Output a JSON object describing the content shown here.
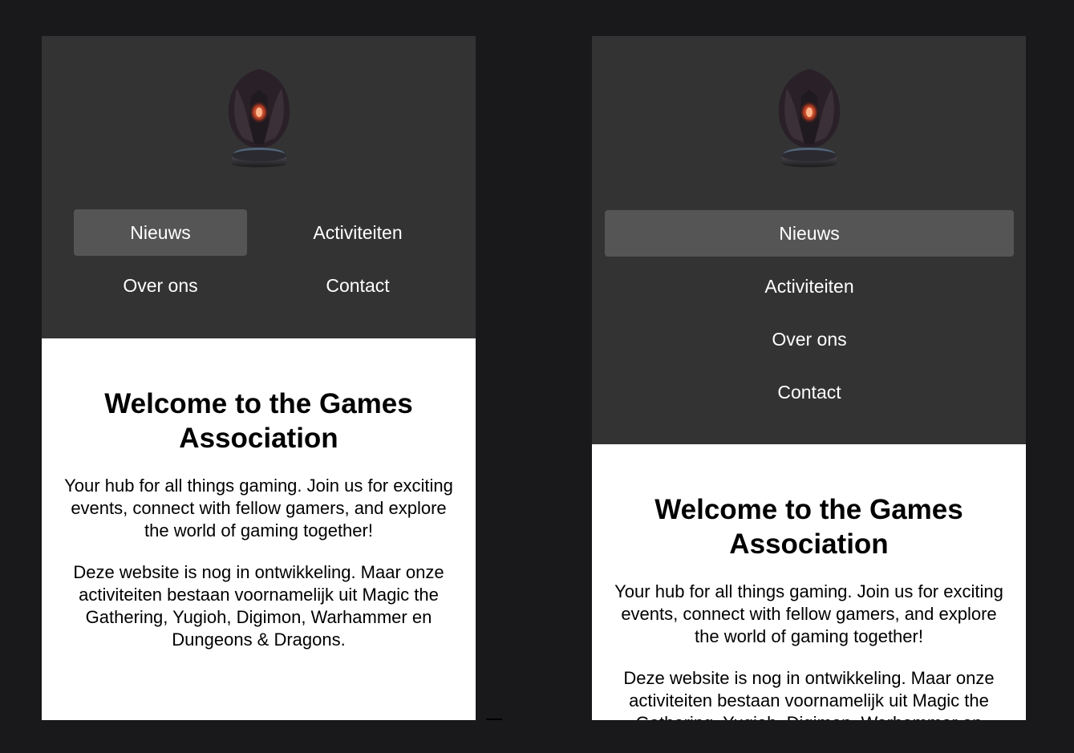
{
  "nav": {
    "items": [
      "Nieuws",
      "Activiteiten",
      "Over ons",
      "Contact"
    ],
    "active": "Nieuws"
  },
  "content": {
    "title": "Welcome to the Games Association",
    "intro": "Your hub for all things gaming. Join us for exciting events, connect with fellow gamers, and explore the world of gaming together!",
    "notice": "Deze website is nog in ontwikkeling. Maar onze activiteiten bestaan voornamelijk uit Magic the Gathering, Yugioh, Digimon, Warhammer en Dungeons & Dragons."
  },
  "colors": {
    "background": "#19191b",
    "header": "#333333",
    "nav_active": "#555555",
    "logo_glow": "#d2563a"
  },
  "icons": {
    "logo": "dragon-statue-logo-icon"
  }
}
